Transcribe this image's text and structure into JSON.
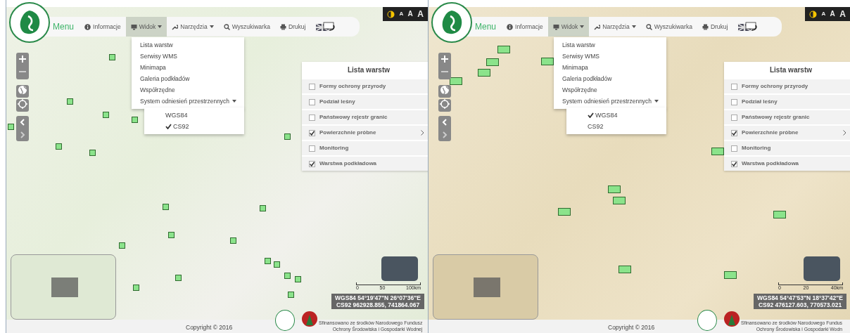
{
  "panels": [
    {
      "menu_label": "Menu",
      "nav": [
        {
          "label": "Informacje",
          "dropdown": false,
          "selected": false
        },
        {
          "label": "Widok",
          "dropdown": true,
          "selected": true
        },
        {
          "label": "Narzędzia",
          "dropdown": true,
          "selected": false
        },
        {
          "label": "Wyszukiwarka",
          "dropdown": false,
          "selected": false
        },
        {
          "label": "Drukuj",
          "dropdown": false,
          "selected": false
        }
      ],
      "font_sizes": [
        "A",
        "A",
        "A"
      ],
      "dropdown": {
        "items": [
          "Lista warstw",
          "Serwisy WMS",
          "Minimapa",
          "Galeria podkładów",
          "Współrzędne"
        ],
        "submenu_label": "System odniesień przestrzennych",
        "submenu": [
          {
            "label": "WGS84",
            "checked": false
          },
          {
            "label": "CS92",
            "checked": true
          }
        ]
      },
      "layers": {
        "title": "Lista warstw",
        "items": [
          {
            "label": "Formy ochrony przyrody",
            "checked": false,
            "has_children": false
          },
          {
            "label": "Podział leśny",
            "checked": false,
            "has_children": false
          },
          {
            "label": "Państwowy rejestr granic",
            "checked": false,
            "has_children": false
          },
          {
            "label": "Powierzchnie próbne",
            "checked": true,
            "has_children": true
          },
          {
            "label": "Monitoring",
            "checked": false,
            "has_children": false
          },
          {
            "label": "Warstwa podkładowa",
            "checked": true,
            "has_children": false
          }
        ]
      },
      "scale": [
        "0",
        "50",
        "100km"
      ],
      "coords": [
        "WGS84 54°19'47\"N 26°07'36\"E",
        "CS92 962928.855, 741864.067"
      ],
      "footer": {
        "copyright": "Copyright © 2016",
        "funding": [
          "Sfinansowano ze środków Narodowego Fundusz",
          "Ochrony Środowiska i Gospodarki Wodnej"
        ]
      }
    },
    {
      "menu_label": "Menu",
      "nav": [
        {
          "label": "Informacje",
          "dropdown": false,
          "selected": false
        },
        {
          "label": "Widok",
          "dropdown": true,
          "selected": true
        },
        {
          "label": "Narzędzia",
          "dropdown": true,
          "selected": false
        },
        {
          "label": "Wyszukiwarka",
          "dropdown": false,
          "selected": false
        },
        {
          "label": "Drukuj",
          "dropdown": false,
          "selected": false
        }
      ],
      "font_sizes": [
        "A",
        "A",
        "A"
      ],
      "dropdown": {
        "items": [
          "Lista warstw",
          "Serwisy WMS",
          "Minimapa",
          "Galeria podkładów",
          "Współrzędne"
        ],
        "submenu_label": "System odniesień przestrzennych",
        "submenu": [
          {
            "label": "WGS84",
            "checked": true
          },
          {
            "label": "CS92",
            "checked": false
          }
        ]
      },
      "layers": {
        "title": "Lista warstw",
        "items": [
          {
            "label": "Formy ochrony przyrody",
            "checked": false,
            "has_children": false
          },
          {
            "label": "Podział leśny",
            "checked": false,
            "has_children": false
          },
          {
            "label": "Państwowy rejestr granic",
            "checked": false,
            "has_children": false
          },
          {
            "label": "Powierzchnie próbne",
            "checked": true,
            "has_children": true
          },
          {
            "label": "Monitoring",
            "checked": false,
            "has_children": false
          },
          {
            "label": "Warstwa podkładowa",
            "checked": true,
            "has_children": false
          }
        ]
      },
      "scale": [
        "0",
        "20",
        "40km"
      ],
      "coords": [
        "WGS84 54°47'53\"N 18°37'42\"E",
        "CS92 476127.603, 770573.021"
      ],
      "footer": {
        "copyright": "Copyright © 2016",
        "funding": [
          "Sfinansowano ze środków Narodowego Fundus",
          "Ochrony Środowiska i Gospodarki Wodn"
        ]
      }
    }
  ]
}
